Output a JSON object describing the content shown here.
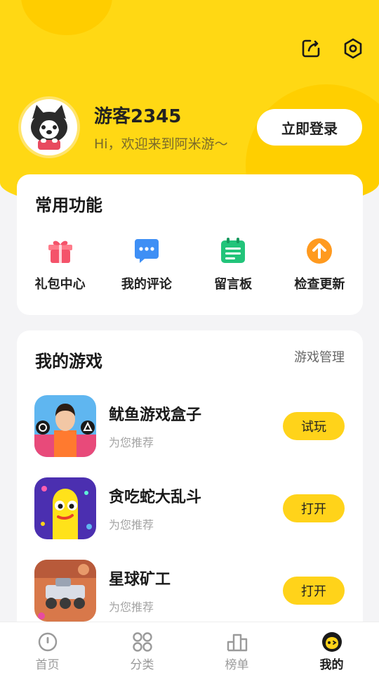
{
  "header": {
    "username": "游客2345",
    "greeting": "Hi，欢迎来到阿米游～",
    "login_label": "立即登录",
    "icons": [
      "edit-icon",
      "settings-icon"
    ]
  },
  "functions": {
    "title": "常用功能",
    "items": [
      {
        "label": "礼包中心",
        "icon": "gift-icon",
        "color": "#f4536a"
      },
      {
        "label": "我的评论",
        "icon": "comment-icon",
        "color": "#3e8ff5"
      },
      {
        "label": "留言板",
        "icon": "message-board-icon",
        "color": "#22c47a"
      },
      {
        "label": "检查更新",
        "icon": "update-icon",
        "color": "#ff9a1f"
      }
    ]
  },
  "games": {
    "title": "我的游戏",
    "manage_label": "游戏管理",
    "items": [
      {
        "name": "鱿鱼游戏盒子",
        "sub": "为您推荐",
        "action": "试玩"
      },
      {
        "name": "贪吃蛇大乱斗",
        "sub": "为您推荐",
        "action": "打开"
      },
      {
        "name": "星球矿工",
        "sub": "为您推荐",
        "action": "打开"
      }
    ]
  },
  "tabbar": {
    "items": [
      {
        "label": "首页",
        "icon": "home-icon",
        "active": false
      },
      {
        "label": "分类",
        "icon": "category-icon",
        "active": false
      },
      {
        "label": "榜单",
        "icon": "ranking-icon",
        "active": false
      },
      {
        "label": "我的",
        "icon": "mine-icon",
        "active": true
      }
    ]
  },
  "colors": {
    "accent": "#ffd814",
    "button": "#ffd31a"
  }
}
